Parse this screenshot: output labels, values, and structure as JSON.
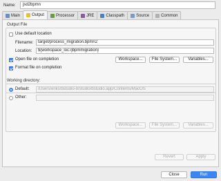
{
  "name_label": "Name:",
  "name_value": "jsd2bpmn",
  "tabs": [
    {
      "label": "Main",
      "icon": "main-tab-icon",
      "color": "#6c8fbf"
    },
    {
      "label": "Output",
      "icon": "output-tab-icon",
      "color": "#e2c044"
    },
    {
      "label": "Processor",
      "icon": "processor-tab-icon",
      "color": "#6b9a3e"
    },
    {
      "label": "JRE",
      "icon": "jre-tab-icon",
      "color": "#8a5a9a"
    },
    {
      "label": "Classpath",
      "icon": "classpath-tab-icon",
      "color": "#4e7fbf"
    },
    {
      "label": "Source",
      "icon": "source-tab-icon",
      "color": "#7a9cc4"
    },
    {
      "label": "Common",
      "icon": "common-tab-icon",
      "color": "#b0b0b0"
    }
  ],
  "output_file": {
    "title": "Output File",
    "use_default_location": "Use default location",
    "filename_label": "Filename:",
    "filename_value": "target/process_migration.bpmn2",
    "location_label": "Location:",
    "location_value": "${workspace_loc:/jbpmmigration}",
    "open_file_label": "Open file on completion",
    "format_file_label": "Format file on completion",
    "workspace_btn": "Workspace...",
    "filesystem_btn": "File System...",
    "variables_btn": "Variables..."
  },
  "working_directory": {
    "title": "Working directory:",
    "default_label": "Default:",
    "default_value": "/Users/eriks/bstudio-8/studio/bstudio.app/Contents/MacOS",
    "other_label": "Other:",
    "other_value": "",
    "workspace_btn": "Workspace...",
    "filesystem_btn": "File System...",
    "variables_btn": "Variables..."
  },
  "footer": {
    "revert": "Revert",
    "apply": "Apply",
    "close": "Close",
    "run": "Run"
  },
  "colors": {
    "accent": "#3b86f2"
  }
}
